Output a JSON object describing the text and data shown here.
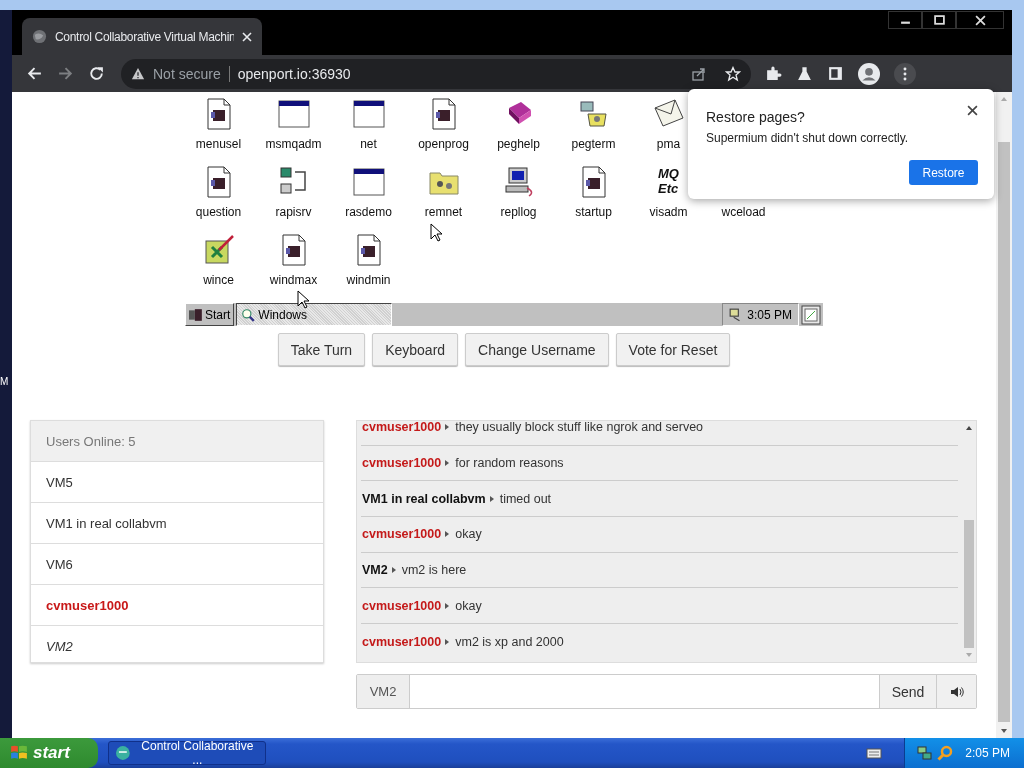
{
  "desktop_edge_text": "M",
  "browser": {
    "tab": {
      "title": "Control Collaborative Virtual Machin"
    },
    "address": {
      "security": "Not secure",
      "url": "openport.io:36930"
    }
  },
  "vm_screen": {
    "icon_rows": [
      [
        {
          "label": "menusel",
          "kind": "doc"
        },
        {
          "label": "msmqadm",
          "kind": "window"
        },
        {
          "label": "net",
          "kind": "window"
        },
        {
          "label": "openprog",
          "kind": "doc"
        },
        {
          "label": "peghelp",
          "kind": "book"
        },
        {
          "label": "pegterm",
          "kind": "phone"
        },
        {
          "label": "pma",
          "kind": "mail"
        }
      ],
      [
        {
          "label": "question",
          "kind": "doc"
        },
        {
          "label": "rapisrv",
          "kind": "network"
        },
        {
          "label": "rasdemo",
          "kind": "window"
        },
        {
          "label": "remnet",
          "kind": "folder"
        },
        {
          "label": "repllog",
          "kind": "computer"
        },
        {
          "label": "startup",
          "kind": "doc"
        },
        {
          "label": "visadm",
          "kind": "text",
          "icon_text": [
            "MQ",
            "Etc"
          ]
        },
        {
          "label": "wceload"
        }
      ],
      [
        {
          "label": "wince",
          "kind": "wince"
        },
        {
          "label": "windmax",
          "kind": "doc"
        },
        {
          "label": "windmin",
          "kind": "doc"
        }
      ]
    ],
    "taskbar": {
      "start": "Start",
      "task": "Windows",
      "clock": "3:05 PM"
    }
  },
  "controls": [
    "Take Turn",
    "Keyboard",
    "Change Username",
    "Vote for Reset"
  ],
  "users": {
    "header": "Users Online: 5",
    "items": [
      {
        "name": "VM5",
        "kind": "plain"
      },
      {
        "name": "VM1 in real collabvm",
        "kind": "plain"
      },
      {
        "name": "VM6",
        "kind": "plain"
      },
      {
        "name": "cvmuser1000",
        "kind": "self"
      },
      {
        "name": "VM2",
        "kind": "italic"
      }
    ]
  },
  "chat": {
    "messages": [
      {
        "user": "cvmuser1000",
        "kind": "self",
        "text": "they usually block stuff like ngrok and serveo"
      },
      {
        "user": "cvmuser1000",
        "kind": "self",
        "text": "for random reasons"
      },
      {
        "user": "VM1 in real collabvm",
        "kind": "other",
        "text": "timed out"
      },
      {
        "user": "cvmuser1000",
        "kind": "self",
        "text": "okay"
      },
      {
        "user": "VM2",
        "kind": "other",
        "text": "vm2 is here"
      },
      {
        "user": "cvmuser1000",
        "kind": "self",
        "text": "okay"
      },
      {
        "user": "cvmuser1000",
        "kind": "self",
        "text": "vm2 is xp and 2000"
      }
    ],
    "username": "VM2",
    "send": "Send"
  },
  "restore_popup": {
    "title": "Restore pages?",
    "message": "Supermium didn't shut down correctly.",
    "button": "Restore"
  },
  "taskbar": {
    "start": "start",
    "task": "Control Collaborative ...",
    "clock": "2:05 PM"
  }
}
